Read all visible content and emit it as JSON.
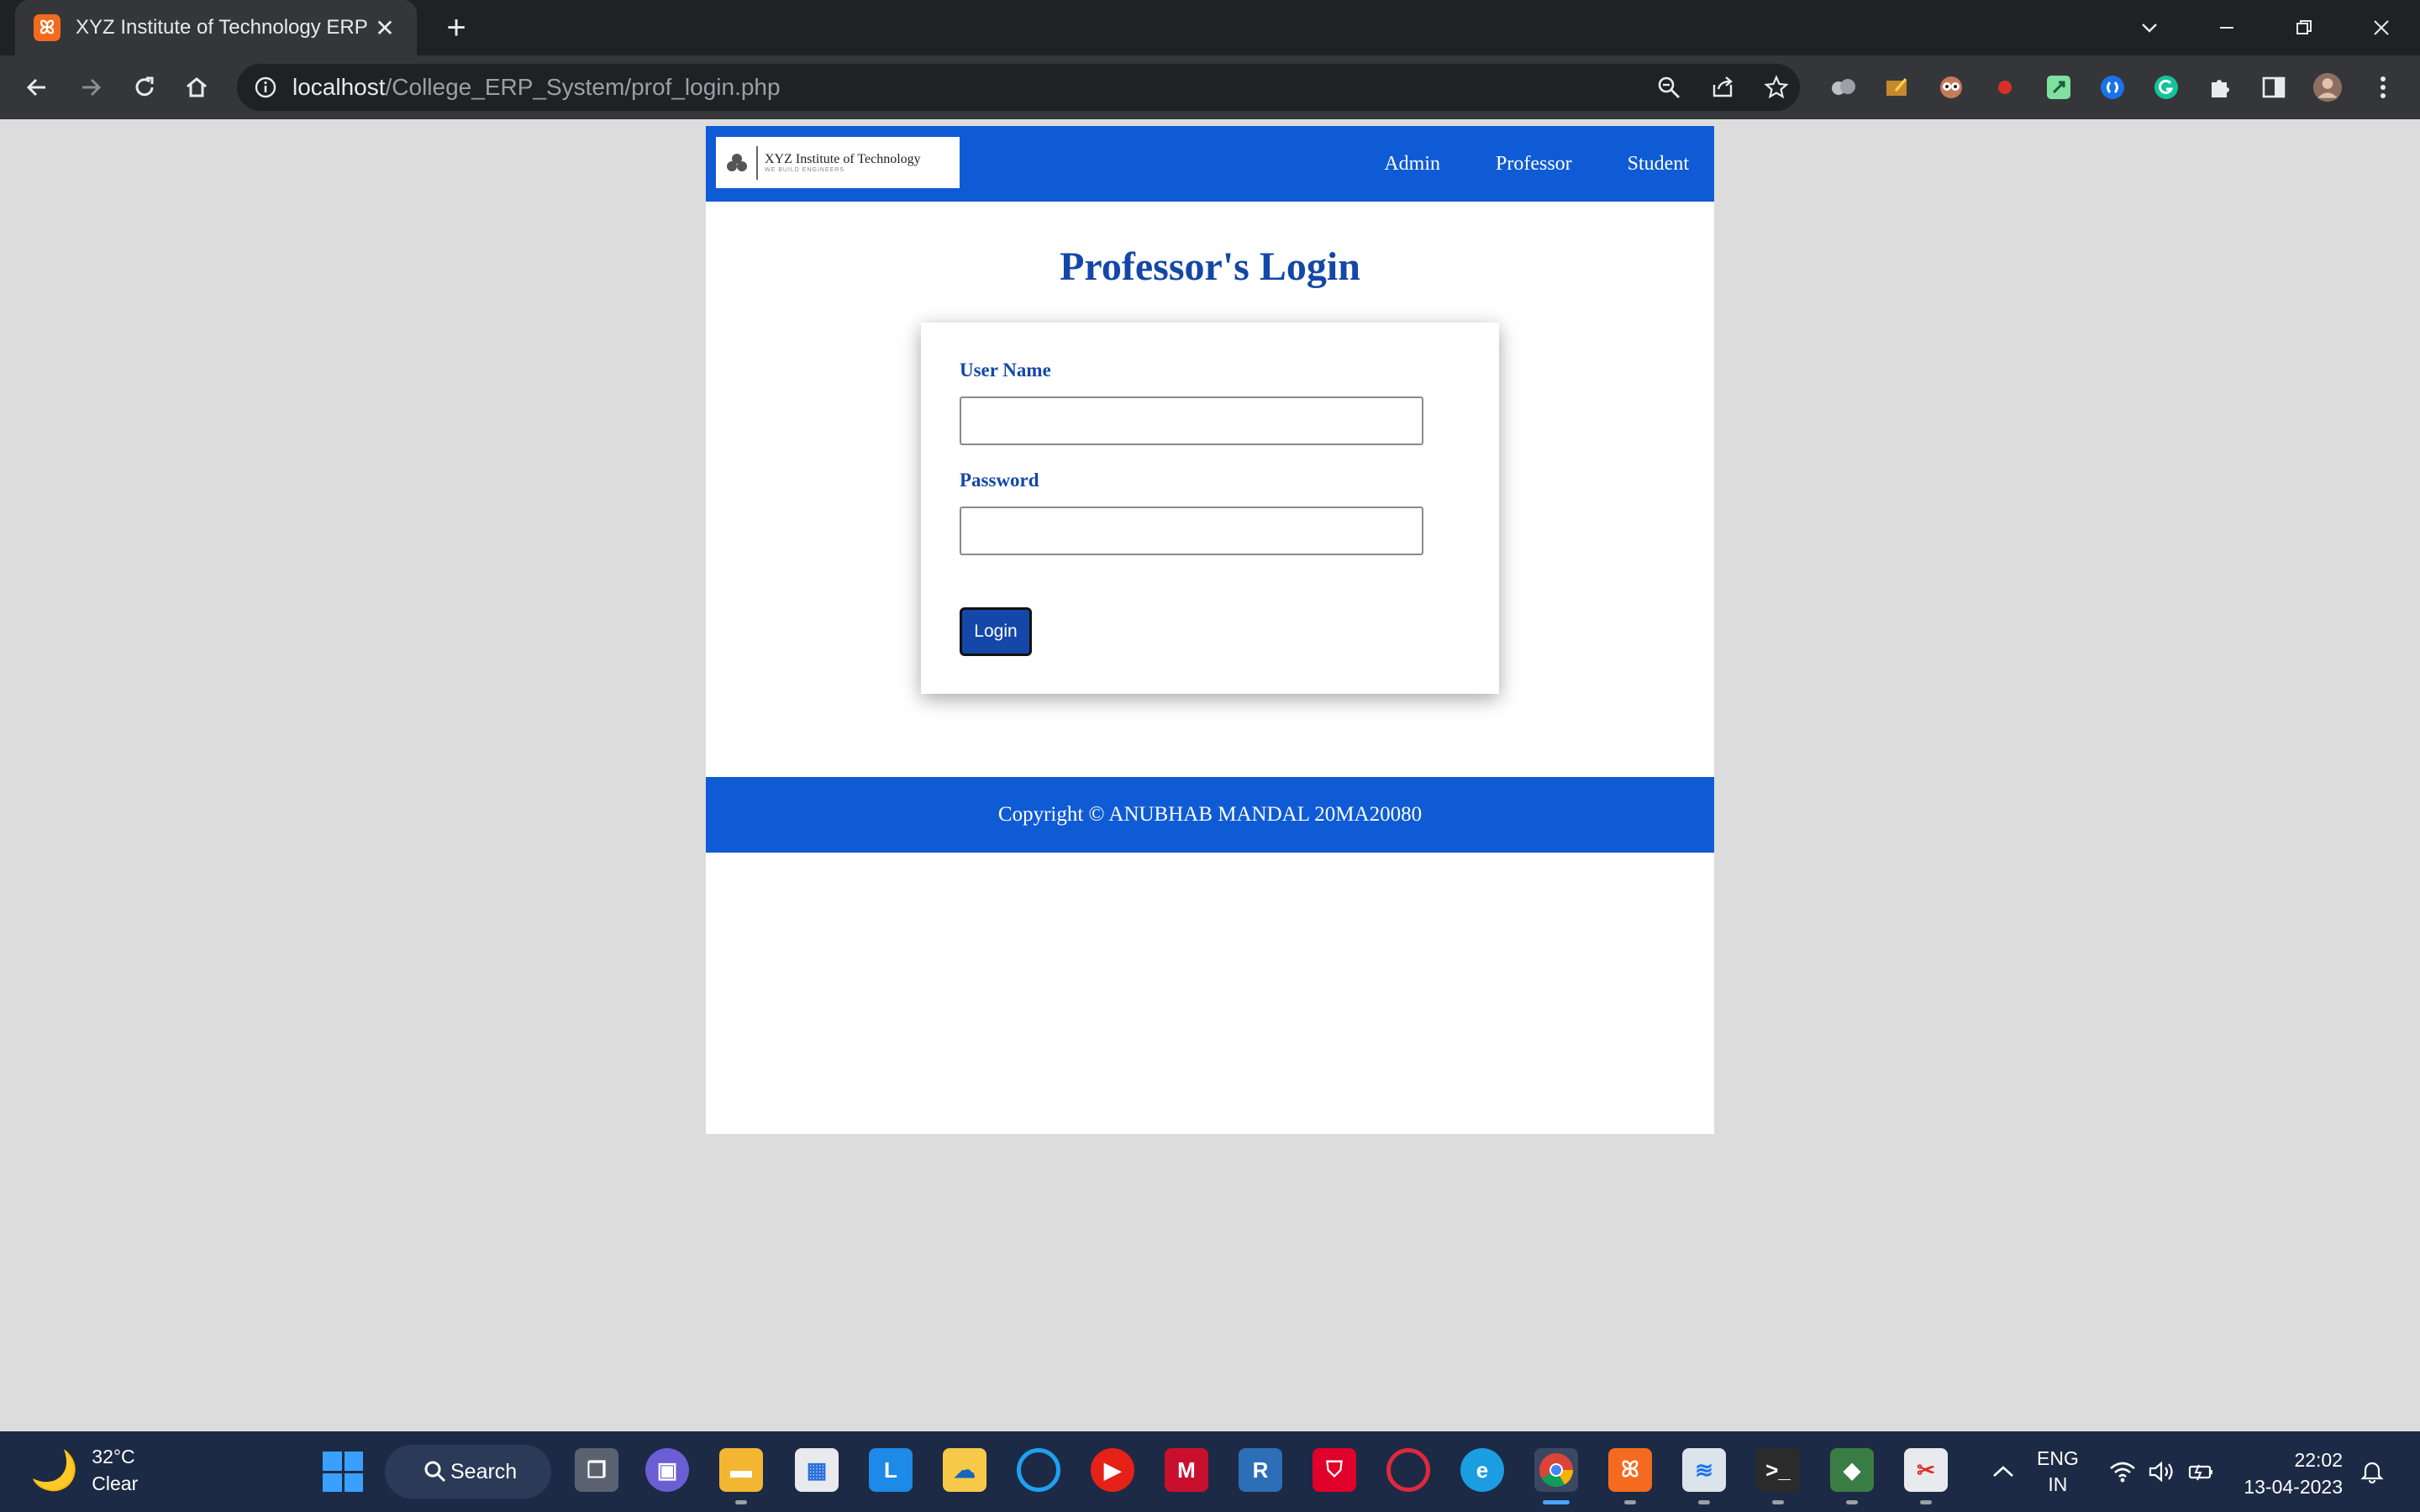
{
  "browser": {
    "tab_title": "XYZ Institute of Technology ERP",
    "tab_favicon": "xampp-icon",
    "url_host": "localhost",
    "url_path": "/College_ERP_System/prof_login.php"
  },
  "site": {
    "logo_text": "XYZ Institute of Technology",
    "logo_subtext": "WE BUILD ENGINEERS",
    "nav": [
      "Admin",
      "Professor",
      "Student"
    ],
    "brand_color": "#0f5bd6",
    "accent_color": "#1447a7"
  },
  "login": {
    "title": "Professor's Login",
    "username_label": "User Name",
    "username_value": "",
    "password_label": "Password",
    "password_value": "",
    "button_label": "Login"
  },
  "footer": {
    "copyright": "Copyright © ANUBHAB MANDAL 20MA20080"
  },
  "taskbar": {
    "temperature": "32°C",
    "weather": "Clear",
    "search_label": "Search",
    "language": "ENG",
    "region": "IN",
    "time": "22:02",
    "date": "13-04-2023"
  }
}
